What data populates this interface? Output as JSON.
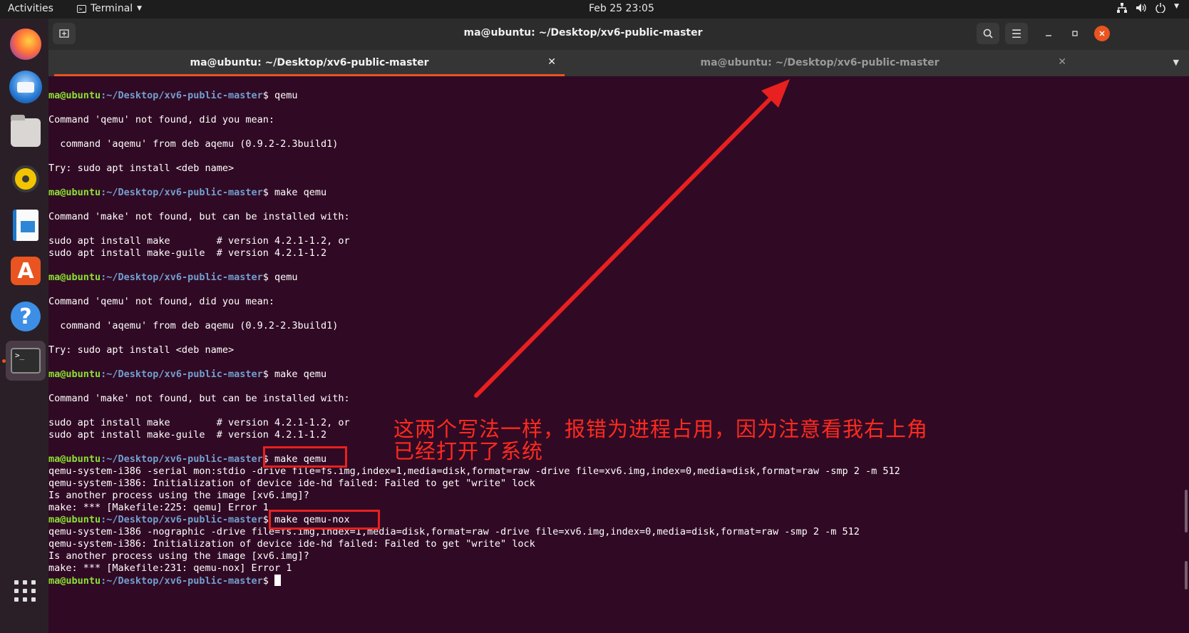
{
  "topbar": {
    "activities": "Activities",
    "app_name": "Terminal",
    "clock": "Feb 25  23:05",
    "tray_icons": [
      "network-icon",
      "volume-icon",
      "power-icon"
    ]
  },
  "dock": {
    "apps": [
      "firefox",
      "thunderbird",
      "files",
      "rhythmbox",
      "libreoffice-writer",
      "ubuntu-software",
      "help",
      "terminal"
    ],
    "terminal_glyph": ">_"
  },
  "window": {
    "title": "ma@ubuntu: ~/Desktop/xv6-public-master",
    "tabs": [
      {
        "label": "ma@ubuntu: ~/Desktop/xv6-public-master",
        "active": true
      },
      {
        "label": "ma@ubuntu: ~/Desktop/xv6-public-master",
        "active": false
      }
    ]
  },
  "prompt": {
    "user": "ma@ubuntu",
    "path": ":~/Desktop/xv6-public-master",
    "symbol": "$ "
  },
  "terminal_lines": [
    {
      "prompt": true,
      "text": "qemu"
    },
    {
      "text": ""
    },
    {
      "text": "Command 'qemu' not found, did you mean:"
    },
    {
      "text": ""
    },
    {
      "text": "  command 'aqemu' from deb aqemu (0.9.2-2.3build1)"
    },
    {
      "text": ""
    },
    {
      "text": "Try: sudo apt install <deb name>"
    },
    {
      "text": ""
    },
    {
      "prompt": true,
      "text": "make qemu"
    },
    {
      "text": ""
    },
    {
      "text": "Command 'make' not found, but can be installed with:"
    },
    {
      "text": ""
    },
    {
      "text": "sudo apt install make        # version 4.2.1-1.2, or"
    },
    {
      "text": "sudo apt install make-guile  # version 4.2.1-1.2"
    },
    {
      "text": ""
    },
    {
      "prompt": true,
      "text": "qemu"
    },
    {
      "text": ""
    },
    {
      "text": "Command 'qemu' not found, did you mean:"
    },
    {
      "text": ""
    },
    {
      "text": "  command 'aqemu' from deb aqemu (0.9.2-2.3build1)"
    },
    {
      "text": ""
    },
    {
      "text": "Try: sudo apt install <deb name>"
    },
    {
      "text": ""
    },
    {
      "prompt": true,
      "text": "make qemu"
    },
    {
      "text": ""
    },
    {
      "text": "Command 'make' not found, but can be installed with:"
    },
    {
      "text": ""
    },
    {
      "text": "sudo apt install make        # version 4.2.1-1.2, or"
    },
    {
      "text": "sudo apt install make-guile  # version 4.2.1-1.2"
    },
    {
      "text": ""
    },
    {
      "prompt": true,
      "text": "make qemu"
    },
    {
      "text": "qemu-system-i386 -serial mon:stdio -drive file=fs.img,index=1,media=disk,format=raw -drive file=xv6.img,index=0,media=disk,format=raw -smp 2 -m 512"
    },
    {
      "text": "qemu-system-i386: Initialization of device ide-hd failed: Failed to get \"write\" lock"
    },
    {
      "text": "Is another process using the image [xv6.img]?"
    },
    {
      "text": "make: *** [Makefile:225: qemu] Error 1"
    },
    {
      "prompt": true,
      "text": "make qemu-nox"
    },
    {
      "text": "qemu-system-i386 -nographic -drive file=fs.img,index=1,media=disk,format=raw -drive file=xv6.img,index=0,media=disk,format=raw -smp 2 -m 512"
    },
    {
      "text": "qemu-system-i386: Initialization of device ide-hd failed: Failed to get \"write\" lock"
    },
    {
      "text": "Is another process using the image [xv6.img]?"
    },
    {
      "text": "make: *** [Makefile:231: qemu-nox] Error 1"
    },
    {
      "prompt": true,
      "text": "",
      "cursor": true
    }
  ],
  "annotation": {
    "line1": "这两个写法一样，报错为进程占用，因为注意看我右上角",
    "line2": "已经打开了系统"
  },
  "colors": {
    "terminal_bg": "#300a24",
    "prompt_user": "#8ae234",
    "prompt_path": "#729fcf",
    "accent": "#e95420",
    "annotation": "#e8201f"
  }
}
